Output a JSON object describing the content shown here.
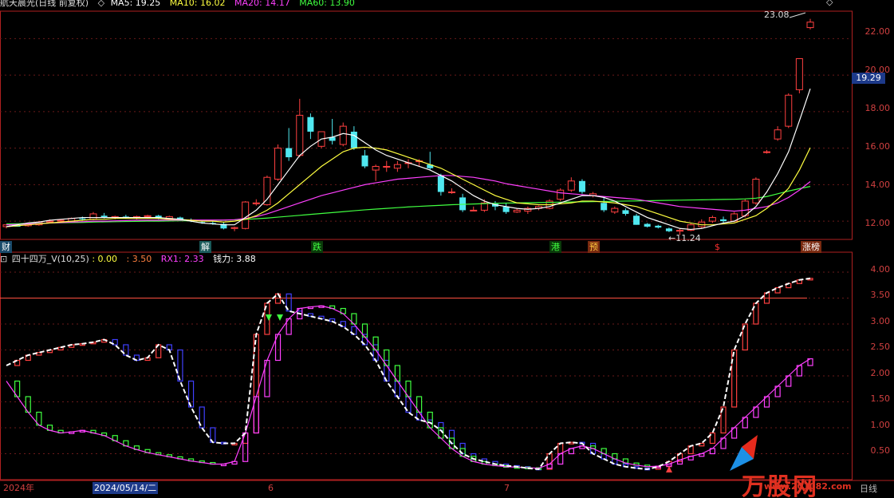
{
  "header": {
    "stock": "航天晨光(日线 前复权)",
    "ma5": "MA5: 19.25",
    "ma10": "MA10: 16.02",
    "ma20": "MA20: 14.17",
    "ma60": "MA60: 13.90"
  },
  "indicator_header": {
    "name": "四十四万_V(10,25)",
    "v0": ": 0.00",
    "v1": ": 3.50",
    "rx1": "RX1: 2.33",
    "qianli": "钱力: 3.88"
  },
  "price_axis": [
    "22.00",
    "20.00",
    "18.00",
    "16.00",
    "14.00",
    "12.00"
  ],
  "indicator_axis": [
    "4.00",
    "3.50",
    "3.00",
    "2.50",
    "2.00",
    "1.50",
    "1.00",
    "0.50"
  ],
  "current_price_label": "19.29",
  "annotations": {
    "high": "23.08",
    "low": "←11.24",
    "dollar": "$"
  },
  "tags": [
    {
      "text": "财",
      "color": "#ffffff",
      "bg": "#1a4a6a"
    },
    {
      "text": "解",
      "color": "#ffffff",
      "bg": "#1a5a5a"
    },
    {
      "text": "跌",
      "color": "#40ff40",
      "bg": "#0a3a0a"
    },
    {
      "text": "港",
      "color": "#40ff40",
      "bg": "#0a3a0a"
    },
    {
      "text": "预",
      "color": "#ffcc40",
      "bg": "#7a2a10"
    },
    {
      "text": "涨榜",
      "color": "#ffffff",
      "bg": "#7a2a10"
    }
  ],
  "dates": {
    "year": "2024年",
    "selected": "2024/05/14/二",
    "m6": "6",
    "m7": "7"
  },
  "period": "日线",
  "watermark": {
    "brand": "万股网",
    "url": "www.201082.com"
  },
  "colors": {
    "up": "#ff4040",
    "down": "#50e8f0",
    "ma5": "#ffffff",
    "ma10": "#ffff40",
    "ma20": "#ff40ff",
    "ma60": "#40ff40",
    "axis": "#b02020",
    "grid": "#6a1a1a",
    "ind_white": "#ffffff",
    "ind_magenta": "#ff40ff",
    "ind_green": "#40ff40",
    "ind_blue": "#4040ff",
    "ind_red": "#ff4040"
  },
  "chart_data": {
    "type": "candlestick",
    "ohlc": [
      [
        11.7,
        11.8,
        11.6,
        11.8
      ],
      [
        11.75,
        11.85,
        11.7,
        11.7
      ],
      [
        11.75,
        11.9,
        11.7,
        11.85
      ],
      [
        11.8,
        12.0,
        11.75,
        11.95
      ],
      [
        11.95,
        12.1,
        11.9,
        12.0
      ],
      [
        12.0,
        12.1,
        11.95,
        12.05
      ],
      [
        12.0,
        12.2,
        11.95,
        12.15
      ],
      [
        12.15,
        12.25,
        12.05,
        12.1
      ],
      [
        12.1,
        12.5,
        12.05,
        12.4
      ],
      [
        12.3,
        12.45,
        12.15,
        12.2
      ],
      [
        12.2,
        12.3,
        12.1,
        12.25
      ],
      [
        12.25,
        12.35,
        12.15,
        12.2
      ],
      [
        12.2,
        12.3,
        12.1,
        12.25
      ],
      [
        12.25,
        12.35,
        12.15,
        12.3
      ],
      [
        12.3,
        12.35,
        12.1,
        12.15
      ],
      [
        12.15,
        12.3,
        12.1,
        12.25
      ],
      [
        12.2,
        12.25,
        12.0,
        12.05
      ],
      [
        12.05,
        12.15,
        11.95,
        12.0
      ],
      [
        11.95,
        12.05,
        11.85,
        11.9
      ],
      [
        11.9,
        12.0,
        11.8,
        11.85
      ],
      [
        11.85,
        11.95,
        11.55,
        11.6
      ],
      [
        11.6,
        11.7,
        11.45,
        11.65
      ],
      [
        11.6,
        13.1,
        11.55,
        13.05
      ],
      [
        12.95,
        13.2,
        12.85,
        13.0
      ],
      [
        12.9,
        14.5,
        12.85,
        14.4
      ],
      [
        14.3,
        16.2,
        14.2,
        16.0
      ],
      [
        16.0,
        17.1,
        15.3,
        15.5
      ],
      [
        15.6,
        18.7,
        15.5,
        17.8
      ],
      [
        17.7,
        17.9,
        16.5,
        16.9
      ],
      [
        16.1,
        16.9,
        16.0,
        16.9
      ],
      [
        16.6,
        17.6,
        16.2,
        16.4
      ],
      [
        16.2,
        17.4,
        16.1,
        17.2
      ],
      [
        16.9,
        17.2,
        15.9,
        16.0
      ],
      [
        15.6,
        15.9,
        14.9,
        15.0
      ],
      [
        14.8,
        15.1,
        14.2,
        15.0
      ],
      [
        15.0,
        15.3,
        14.7,
        15.0
      ],
      [
        14.9,
        15.3,
        14.7,
        15.1
      ],
      [
        15.2,
        15.4,
        14.9,
        15.2
      ],
      [
        15.3,
        15.4,
        15.0,
        15.3
      ],
      [
        15.1,
        15.8,
        14.8,
        14.9
      ],
      [
        14.5,
        14.6,
        13.4,
        13.6
      ],
      [
        13.6,
        13.8,
        13.5,
        13.6
      ],
      [
        13.3,
        13.5,
        12.5,
        12.6
      ],
      [
        12.6,
        12.8,
        12.55,
        12.6
      ],
      [
        12.6,
        13.2,
        12.5,
        13.0
      ],
      [
        12.95,
        13.1,
        12.6,
        12.8
      ],
      [
        12.8,
        13.0,
        12.4,
        12.5
      ],
      [
        12.5,
        12.7,
        12.45,
        12.6
      ],
      [
        12.55,
        12.8,
        12.4,
        12.7
      ],
      [
        12.7,
        12.85,
        12.6,
        12.8
      ],
      [
        12.7,
        13.2,
        12.65,
        13.1
      ],
      [
        13.2,
        13.8,
        13.1,
        13.7
      ],
      [
        13.7,
        14.4,
        13.6,
        14.2
      ],
      [
        14.2,
        14.3,
        13.5,
        13.6
      ],
      [
        13.4,
        13.6,
        13.3,
        13.5
      ],
      [
        13.0,
        13.3,
        12.5,
        12.6
      ],
      [
        12.5,
        12.8,
        12.4,
        12.7
      ],
      [
        12.6,
        12.7,
        12.3,
        12.4
      ],
      [
        12.3,
        12.4,
        11.8,
        11.8
      ],
      [
        11.85,
        11.9,
        11.65,
        11.7
      ],
      [
        11.75,
        11.8,
        11.6,
        11.65
      ],
      [
        11.6,
        11.65,
        11.4,
        11.45
      ],
      [
        11.45,
        11.6,
        11.24,
        11.5
      ],
      [
        11.5,
        11.9,
        11.45,
        11.8
      ],
      [
        11.7,
        12.1,
        11.6,
        11.95
      ],
      [
        12.0,
        12.3,
        11.9,
        12.2
      ],
      [
        12.1,
        12.25,
        11.9,
        12.0
      ],
      [
        12.0,
        12.5,
        11.95,
        12.4
      ],
      [
        12.3,
        13.2,
        12.2,
        13.1
      ],
      [
        13.0,
        14.4,
        12.9,
        14.3
      ],
      [
        15.8,
        15.9,
        15.7,
        15.8
      ],
      [
        16.5,
        17.2,
        16.4,
        17.0
      ],
      [
        17.2,
        19.0,
        17.1,
        18.9
      ],
      [
        19.2,
        20.9,
        19.0,
        20.9
      ],
      [
        22.6,
        23.08,
        22.5,
        22.9
      ]
    ],
    "ma5": [
      11.7,
      11.8,
      11.9,
      11.95,
      12.05,
      12.1,
      12.15,
      12.2,
      12.2,
      12.2,
      12.2,
      12.2,
      12.2,
      12.2,
      12.2,
      12.15,
      12.1,
      12.0,
      11.9,
      11.85,
      11.8,
      11.8,
      12.2,
      12.6,
      13.2,
      14.0,
      14.8,
      15.6,
      16.1,
      16.5,
      16.6,
      16.8,
      16.7,
      16.3,
      15.9,
      15.6,
      15.4,
      15.2,
      15.0,
      14.8,
      14.5,
      14.2,
      13.8,
      13.4,
      13.1,
      12.9,
      12.8,
      12.7,
      12.65,
      12.7,
      12.8,
      13.0,
      13.2,
      13.4,
      13.4,
      13.3,
      13.1,
      12.8,
      12.5,
      12.2,
      12.0,
      11.8,
      11.6,
      11.55,
      11.6,
      11.75,
      11.9,
      12.0,
      12.3,
      12.8,
      13.6,
      14.6,
      15.8,
      17.5,
      19.25
    ],
    "ma10": [
      11.7,
      11.75,
      11.8,
      11.85,
      11.9,
      11.95,
      12.0,
      12.05,
      12.1,
      12.1,
      12.15,
      12.15,
      12.15,
      12.15,
      12.15,
      12.1,
      12.1,
      12.05,
      12.0,
      12.0,
      11.95,
      12.0,
      12.1,
      12.3,
      12.6,
      13.0,
      13.5,
      14.0,
      14.5,
      15.0,
      15.4,
      15.8,
      16.0,
      16.05,
      16.0,
      15.9,
      15.7,
      15.5,
      15.3,
      15.1,
      14.9,
      14.6,
      14.3,
      14.0,
      13.7,
      13.4,
      13.2,
      13.0,
      12.95,
      12.9,
      12.9,
      12.95,
      13.0,
      13.1,
      13.1,
      13.05,
      13.0,
      12.9,
      12.8,
      12.6,
      12.4,
      12.2,
      12.0,
      11.9,
      11.8,
      11.8,
      11.85,
      11.9,
      12.1,
      12.3,
      12.7,
      13.2,
      13.8,
      14.8,
      16.02
    ],
    "ma20": [
      11.8,
      11.82,
      11.85,
      11.87,
      11.9,
      11.92,
      11.95,
      11.97,
      12.0,
      12.0,
      12.02,
      12.03,
      12.05,
      12.05,
      12.05,
      12.06,
      12.06,
      12.06,
      12.06,
      12.06,
      12.06,
      12.08,
      12.15,
      12.25,
      12.4,
      12.6,
      12.8,
      13.0,
      13.2,
      13.4,
      13.55,
      13.7,
      13.85,
      14.0,
      14.1,
      14.2,
      14.3,
      14.35,
      14.4,
      14.45,
      14.5,
      14.5,
      14.45,
      14.4,
      14.3,
      14.2,
      14.05,
      13.95,
      13.85,
      13.75,
      13.65,
      13.55,
      13.5,
      13.45,
      13.4,
      13.35,
      13.3,
      13.25,
      13.2,
      13.1,
      13.0,
      12.9,
      12.8,
      12.75,
      12.7,
      12.65,
      12.6,
      12.55,
      12.6,
      12.7,
      12.8,
      13.0,
      13.3,
      13.7,
      14.17
    ],
    "ma60": [
      11.85,
      11.86,
      11.87,
      11.88,
      11.9,
      11.91,
      11.92,
      11.93,
      11.95,
      11.96,
      11.97,
      11.98,
      11.99,
      12.0,
      12.0,
      12.01,
      12.02,
      12.02,
      12.03,
      12.04,
      12.05,
      12.07,
      12.1,
      12.13,
      12.17,
      12.22,
      12.27,
      12.32,
      12.37,
      12.42,
      12.47,
      12.52,
      12.57,
      12.62,
      12.66,
      12.7,
      12.74,
      12.78,
      12.81,
      12.84,
      12.87,
      12.9,
      12.92,
      12.94,
      12.96,
      12.98,
      12.99,
      13.0,
      13.01,
      13.02,
      13.03,
      13.04,
      13.05,
      13.06,
      13.07,
      13.08,
      13.09,
      13.1,
      13.11,
      13.12,
      13.13,
      13.14,
      13.15,
      13.16,
      13.17,
      13.18,
      13.19,
      13.2,
      13.22,
      13.26,
      13.35,
      13.5,
      13.65,
      13.78,
      13.9
    ],
    "indicator": {
      "line1": [
        2.2,
        2.3,
        2.4,
        2.45,
        2.5,
        2.55,
        2.6,
        2.62,
        2.65,
        2.7,
        2.6,
        2.4,
        2.3,
        2.35,
        2.6,
        2.5,
        1.9,
        1.4,
        1.0,
        0.72,
        0.7,
        0.7,
        0.9,
        2.8,
        3.4,
        3.58,
        3.25,
        3.2,
        3.15,
        3.1,
        3.05,
        2.95,
        2.8,
        2.6,
        2.3,
        1.9,
        1.6,
        1.3,
        1.15,
        1.1,
        0.95,
        0.7,
        0.5,
        0.4,
        0.35,
        0.3,
        0.27,
        0.25,
        0.22,
        0.2,
        0.5,
        0.7,
        0.72,
        0.7,
        0.5,
        0.4,
        0.3,
        0.25,
        0.22,
        0.2,
        0.25,
        0.35,
        0.5,
        0.65,
        0.7,
        0.9,
        1.4,
        2.5,
        3.0,
        3.4,
        3.6,
        3.7,
        3.78,
        3.85,
        3.88
      ],
      "line2": [
        1.9,
        1.6,
        1.3,
        1.05,
        0.95,
        0.9,
        0.92,
        0.95,
        0.9,
        0.85,
        0.75,
        0.65,
        0.58,
        0.52,
        0.48,
        0.44,
        0.4,
        0.36,
        0.33,
        0.3,
        0.3,
        0.35,
        0.9,
        1.6,
        2.3,
        2.8,
        3.1,
        3.3,
        3.33,
        3.35,
        3.3,
        3.2,
        3.0,
        2.75,
        2.5,
        2.2,
        1.9,
        1.6,
        1.3,
        1.0,
        0.8,
        0.6,
        0.45,
        0.35,
        0.3,
        0.27,
        0.25,
        0.24,
        0.23,
        0.22,
        0.3,
        0.5,
        0.6,
        0.65,
        0.6,
        0.5,
        0.4,
        0.32,
        0.28,
        0.25,
        0.26,
        0.3,
        0.38,
        0.45,
        0.5,
        0.6,
        0.8,
        1.0,
        1.2,
        1.4,
        1.6,
        1.8,
        2.0,
        2.2,
        2.33
      ],
      "h_line": 3.5,
      "ylim": [
        0,
        4.2
      ]
    },
    "ylim": [
      11.0,
      23.5
    ],
    "ylabel": ""
  }
}
